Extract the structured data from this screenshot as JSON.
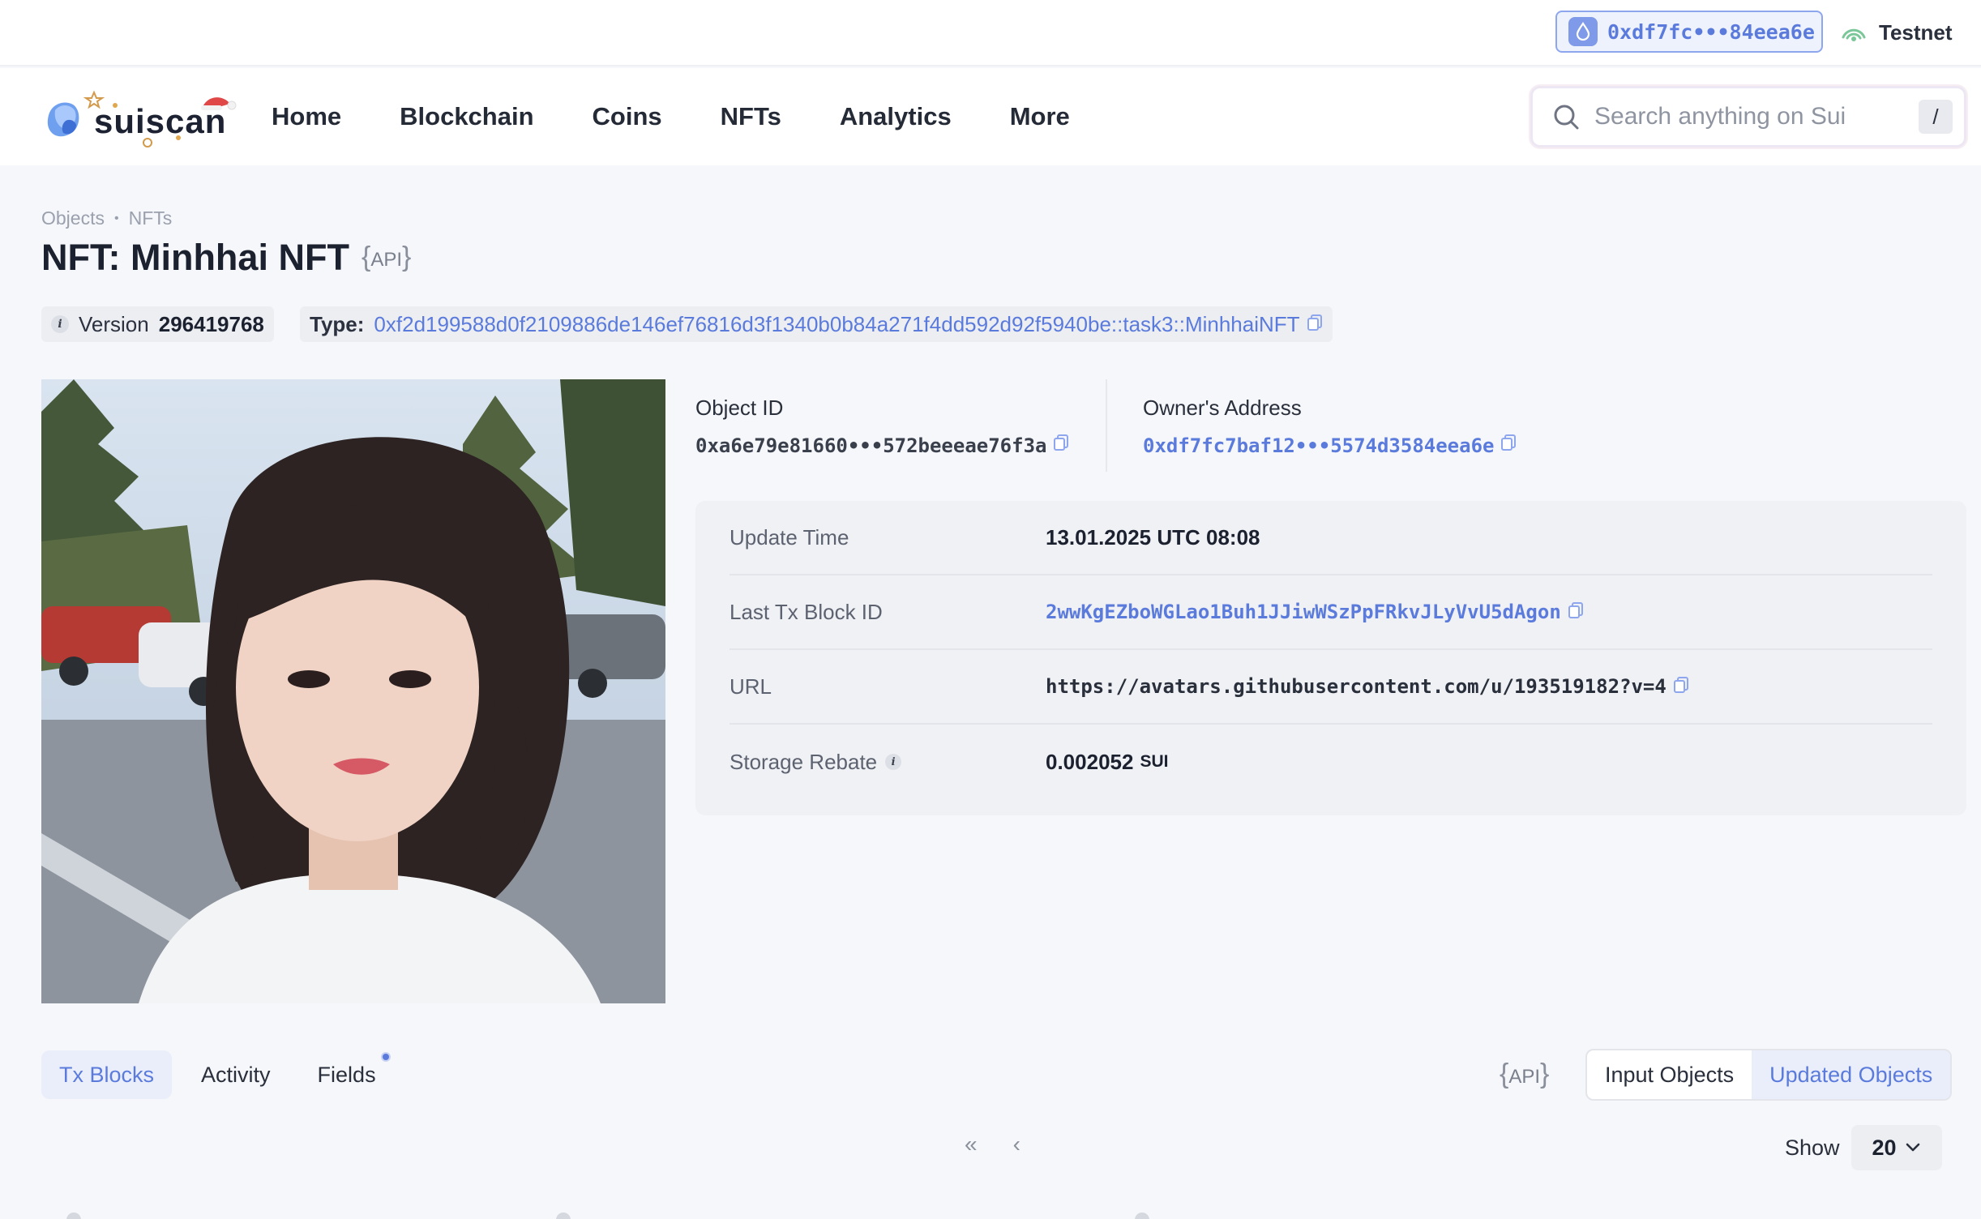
{
  "wallet": {
    "address": "0xdf7fc•••84eea6e",
    "network": "Testnet"
  },
  "nav": {
    "brand": "suiscan",
    "items": [
      "Home",
      "Blockchain",
      "Coins",
      "NFTs",
      "Analytics",
      "More"
    ],
    "search_placeholder": "Search anything on Sui",
    "search_shortcut": "/"
  },
  "header": {
    "breadcrumb": [
      "Objects",
      "NFTs"
    ],
    "title": "NFT: Minhhai NFT",
    "api_label": "API",
    "version_label": "Version",
    "version_value": "296419768",
    "type_label": "Type:",
    "type_value": "0xf2d199588d0f2109886de146ef76816d3f1340b0b84a271f4dd592d92f5940be::task3::MinhhaiNFT"
  },
  "object": {
    "object_id_label": "Object ID",
    "object_id": "0xa6e79e81660•••572beeeae76f3a",
    "owner_label": "Owner's Address",
    "owner": "0xdf7fc7baf12•••5574d3584eea6e"
  },
  "details": [
    {
      "key": "Update Time",
      "value": "13.01.2025 UTC 08:08"
    },
    {
      "key": "Last Tx Block ID",
      "value": "2wwKgEZboWGLao1Buh1JJiwWSzPpFRkvJLyVvU5dAgon"
    },
    {
      "key": "URL",
      "value": "https://avatars.githubusercontent.com/u/193519182?v=4"
    },
    {
      "key": "Storage Rebate",
      "value": "0.002052",
      "unit": "SUI"
    }
  ],
  "tabs": {
    "items": [
      "Tx Blocks",
      "Activity",
      "Fields"
    ],
    "active": "Tx Blocks",
    "api_label": "API"
  },
  "segment": {
    "items": [
      "Input Objects",
      "Updated Objects"
    ],
    "active": "Updated Objects"
  },
  "pager": {
    "first": "«",
    "prev": "‹"
  },
  "show": {
    "label": "Show",
    "value": "20"
  },
  "colors": {
    "accent": "#5b7bdc",
    "background": "#f6f7fa"
  }
}
